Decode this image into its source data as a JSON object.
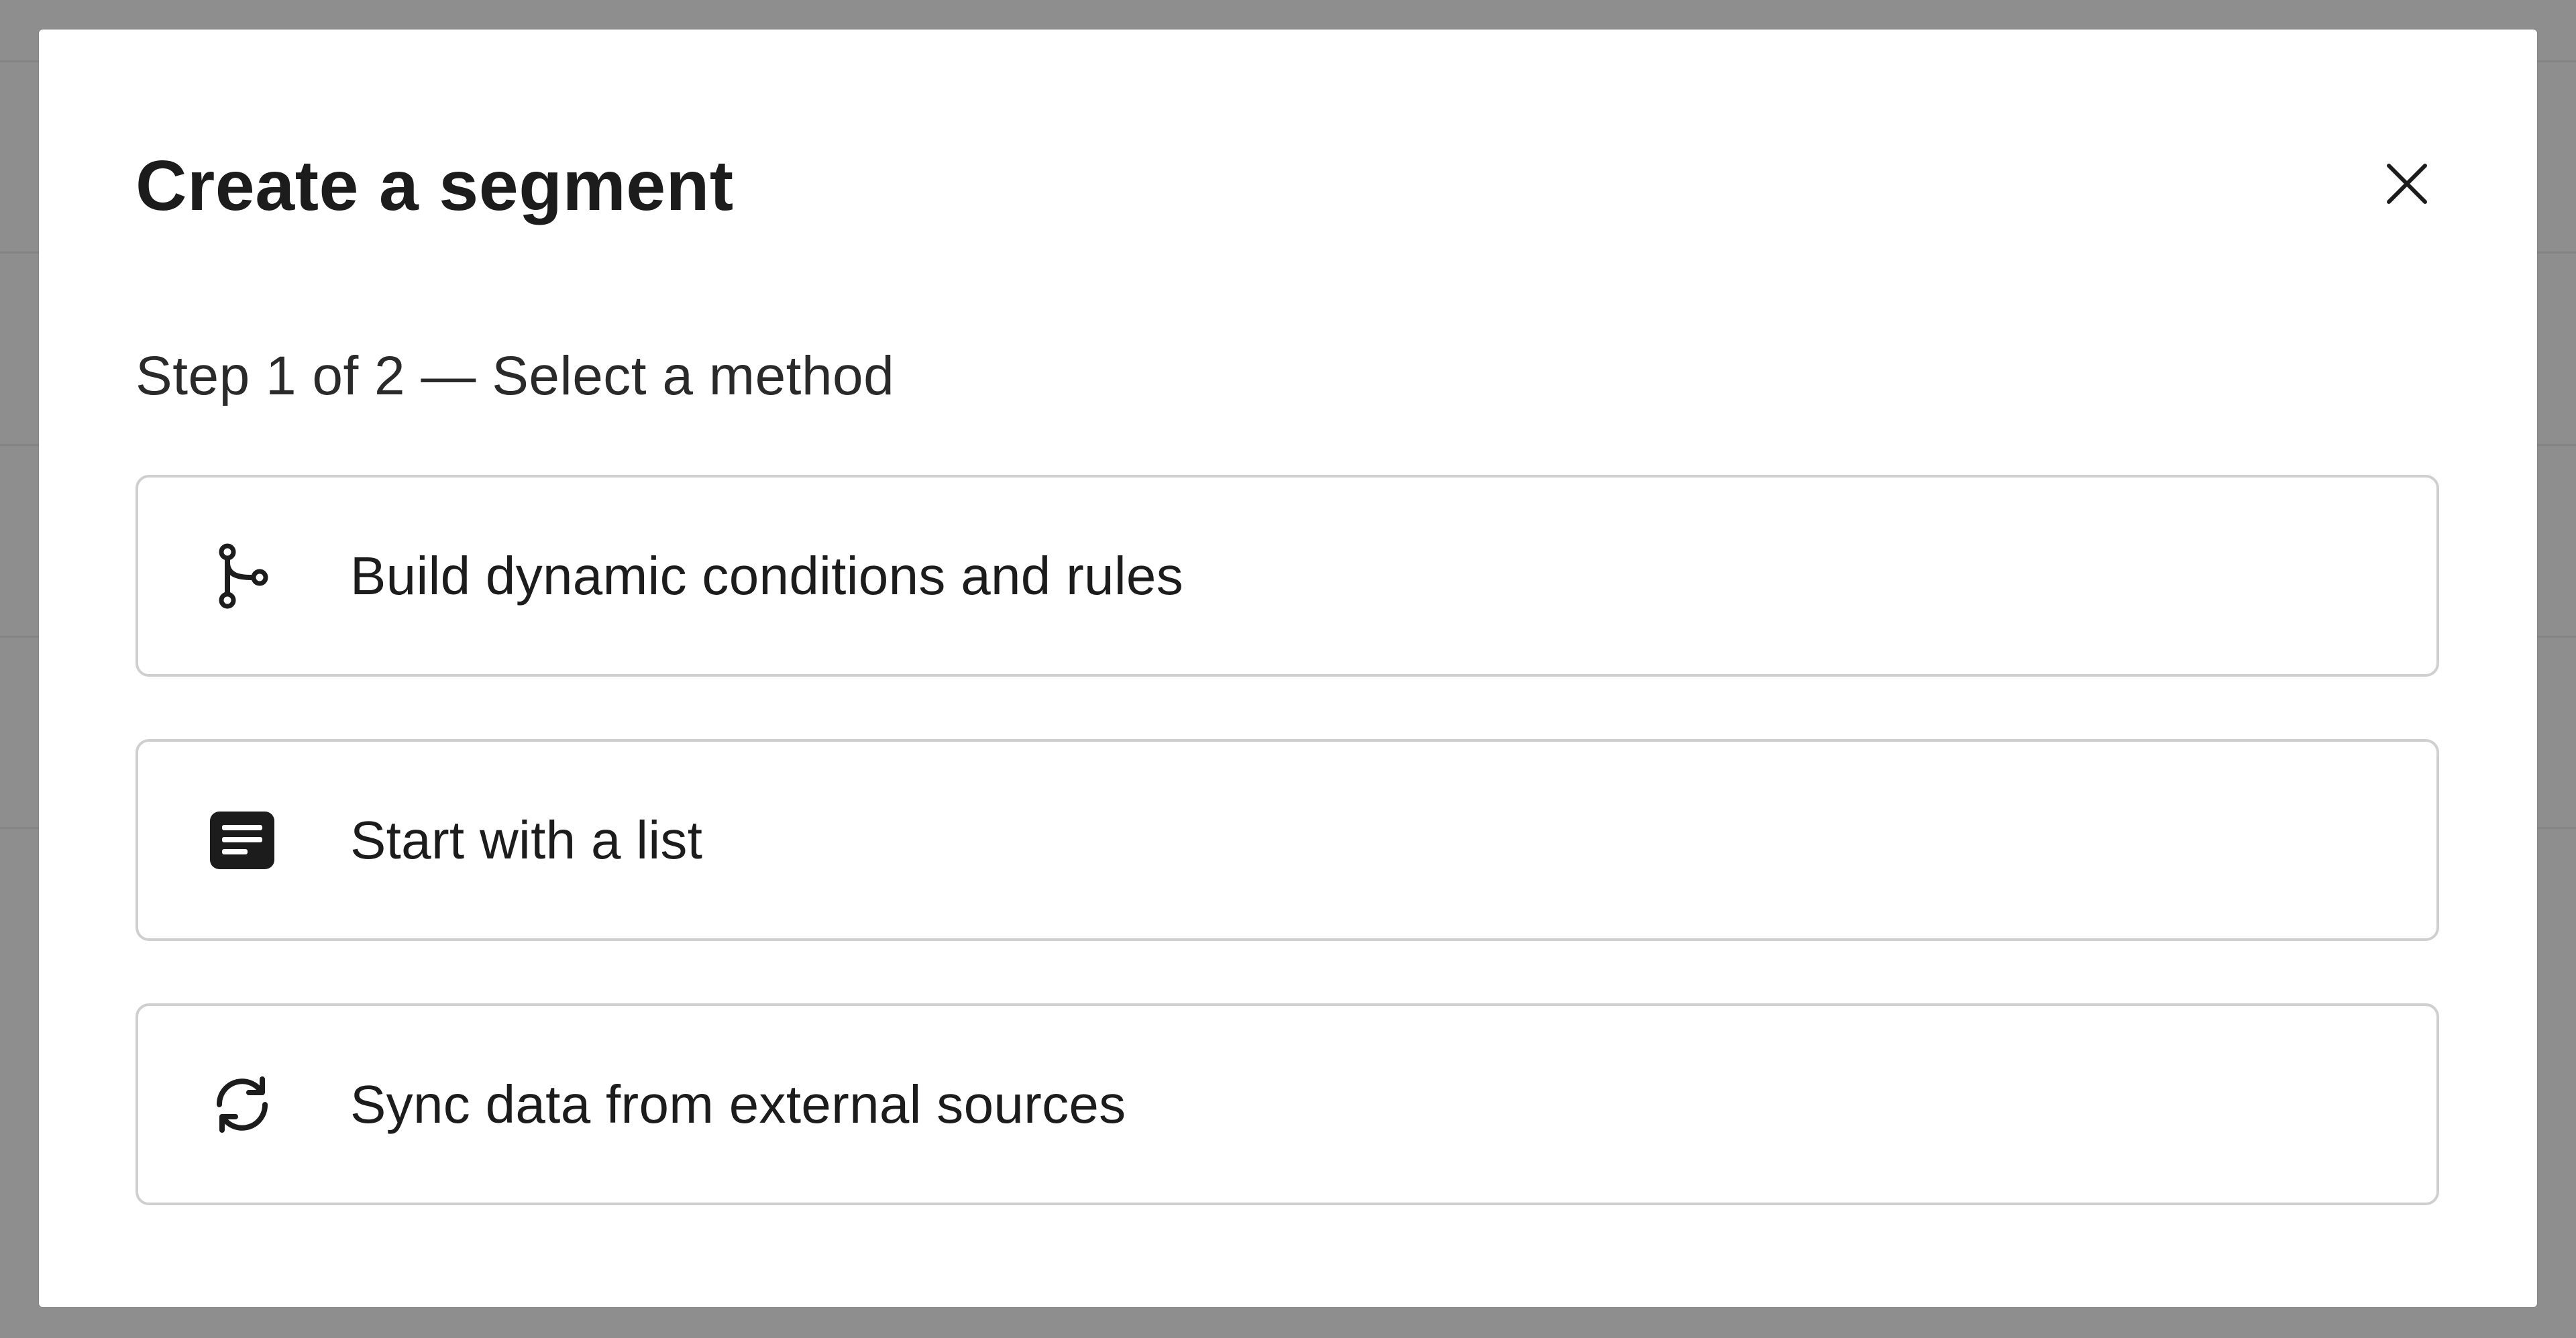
{
  "modal": {
    "title": "Create a segment",
    "step_text": "Step 1 of 2 — Select a method",
    "close_icon": "close-icon"
  },
  "options": [
    {
      "label": "Build dynamic conditions and rules",
      "icon": "branch-icon"
    },
    {
      "label": "Start with a list",
      "icon": "list-icon"
    },
    {
      "label": "Sync data from external sources",
      "icon": "sync-icon"
    }
  ],
  "colors": {
    "overlay": "#8e8e8e",
    "modal_bg": "#ffffff",
    "text": "#1c1c1c",
    "option_border": "#cfcfcf"
  }
}
